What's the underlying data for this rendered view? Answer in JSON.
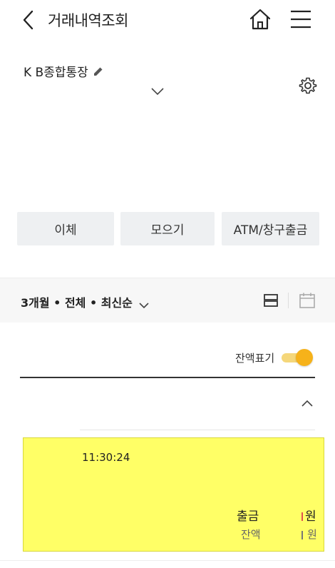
{
  "header": {
    "title": "거래내역조회",
    "icons": [
      "back-icon",
      "home-icon",
      "menu-icon"
    ]
  },
  "account": {
    "name": "K B종합통장"
  },
  "actions": {
    "transfer": "이체",
    "save": "모으기",
    "atm": "ATM/창구출금"
  },
  "filter": {
    "label": "3개월 • 전체 • 최신순"
  },
  "balance_toggle": {
    "label": "잔액표기",
    "on": true
  },
  "transaction": {
    "time": "11:30:24",
    "type": "출금",
    "amount_unit": "원",
    "balance_label": "잔액",
    "balance_unit": "원",
    "highlight_color": "#ffff66"
  },
  "colors": {
    "accent": "#f6b21a",
    "button_bg": "#eef0f2"
  }
}
